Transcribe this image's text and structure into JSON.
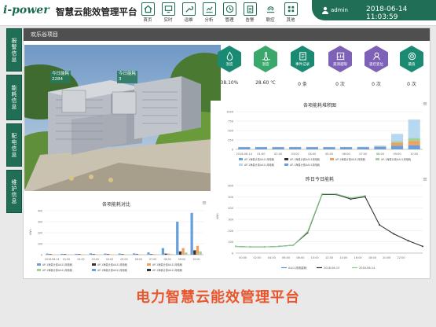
{
  "header": {
    "logo": "i-power",
    "title": "智慧云能效管理平台",
    "username": "admin",
    "datetime": "2018-06-14 11:03:59"
  },
  "nav": [
    {
      "label": "首页",
      "icon": "home-icon"
    },
    {
      "label": "实时",
      "icon": "monitor-icon"
    },
    {
      "label": "运维",
      "icon": "wrench-icon"
    },
    {
      "label": "分析",
      "icon": "chart-icon"
    },
    {
      "label": "管理",
      "icon": "clock-icon"
    },
    {
      "label": "告警",
      "icon": "clipboard-icon"
    },
    {
      "label": "联控",
      "icon": "link-icon"
    },
    {
      "label": "其他",
      "icon": "grid-icon"
    }
  ],
  "side_tabs": [
    "报警信息",
    "能耗信息",
    "配电信息",
    "维护信息"
  ],
  "panel": {
    "breadcrumb": "欢乐谷项目"
  },
  "scene": {
    "tag1": {
      "label": "今日能耗",
      "value": "2284"
    },
    "tag2": {
      "label": "今日能耗",
      "value": "3"
    }
  },
  "metrics": [
    {
      "name": "湿度",
      "value": "38.10%",
      "color": "#1a8a73",
      "icon": "droplet-icon"
    },
    {
      "name": "温度",
      "value": "28.60 ℃",
      "color": "#3aa86b",
      "icon": "thermometer-icon"
    },
    {
      "name": "事件记录",
      "value": "0 条",
      "color": "#1a8a73",
      "icon": "document-icon"
    },
    {
      "name": "遥测越限",
      "value": "0 次",
      "color": "#7d62b7",
      "icon": "gauge-icon"
    },
    {
      "name": "遥控变位",
      "value": "0 次",
      "color": "#7d62b7",
      "icon": "switch-icon"
    },
    {
      "name": "最值",
      "value": "0 次",
      "color": "#1a8a73",
      "icon": "target-icon"
    }
  ],
  "chart_data": [
    {
      "type": "bar",
      "title": "各项能耗堆积图",
      "categories": [
        "2018-06-14",
        "01:00",
        "02:00",
        "03:00",
        "04:00",
        "05:00",
        "06:00",
        "07:00",
        "08:00",
        "09:00",
        "10:00"
      ],
      "ylim": [
        0,
        1000
      ],
      "yticks": [
        0,
        250,
        500,
        750,
        1000
      ],
      "stacked": true,
      "series": [
        {
          "name": "AP-1海量计费AA11用电耗",
          "color": "#6aa0d8",
          "values": [
            60,
            60,
            60,
            60,
            60,
            60,
            60,
            60,
            70,
            100,
            110
          ]
        },
        {
          "name": "AP-1海量计费AA11用电耗",
          "color": "#333333",
          "values": [
            0,
            0,
            0,
            0,
            0,
            0,
            0,
            0,
            0,
            0,
            0
          ]
        },
        {
          "name": "AP-1海量计费AA11用电耗",
          "color": "#f0a060",
          "values": [
            5,
            5,
            5,
            5,
            5,
            5,
            5,
            5,
            10,
            80,
            110
          ]
        },
        {
          "name": "AP-1海量计费AA11用电耗",
          "color": "#9ed39e",
          "values": [
            0,
            0,
            0,
            0,
            0,
            0,
            0,
            0,
            0,
            30,
            80
          ]
        },
        {
          "name": "AP-1海量计费AA11用电耗",
          "color": "#b7d8f0",
          "values": [
            0,
            0,
            0,
            0,
            0,
            0,
            0,
            5,
            20,
            200,
            490
          ]
        }
      ],
      "legend": [
        "AP-1海量计费AA11用电耗",
        "AP-1海量计费AA11用电耗",
        "AP-1海量计费AA11用电耗",
        "AP-1海量计费AA11用电耗",
        "AP-1海量计费AA11用电耗",
        "AP-1海量计费AA11用电耗"
      ]
    },
    {
      "type": "line",
      "title": "昨日今日能耗",
      "ylabel": "kWh",
      "x": [
        "00:00",
        "02:00",
        "04:00",
        "06:00",
        "08:00",
        "10:00",
        "12:00",
        "14:00",
        "16:00",
        "18:00",
        "20:00",
        "22:00"
      ],
      "ylim": [
        0,
        600
      ],
      "yticks": [
        0,
        100,
        200,
        300,
        400,
        500,
        600
      ],
      "series": [
        {
          "name": "AA11用电能耗",
          "color": "#5b9bd5",
          "values": []
        },
        {
          "name": "2018-06-13",
          "color": "#333333",
          "values": [
            60,
            55,
            55,
            60,
            70,
            180,
            520,
            520,
            480,
            500,
            250,
            170,
            110,
            60
          ]
        },
        {
          "name": "2018-06-14",
          "color": "#8ccf8c",
          "values": [
            60,
            55,
            55,
            60,
            70,
            190,
            525,
            525,
            490,
            510
          ]
        }
      ],
      "xtick_count": 14
    },
    {
      "type": "bar",
      "title": "各项能耗对比",
      "ylabel": "kWh",
      "categories": [
        "2018-06-14",
        "01:00",
        "02:00",
        "03:00",
        "04:00",
        "05:00",
        "06:00",
        "07:00",
        "08:00",
        "09:00",
        "10:00"
      ],
      "ylim": [
        0,
        400
      ],
      "yticks": [
        0,
        100,
        200,
        300,
        400
      ],
      "series": [
        {
          "name": "AP-1海量计费AA11用电耗",
          "color": "#6aa0d8",
          "values": [
            10,
            8,
            8,
            12,
            10,
            10,
            12,
            20,
            60,
            300,
            380
          ]
        },
        {
          "name": "AP-1海量计费AA11用电耗",
          "color": "#333333",
          "values": [
            5,
            5,
            5,
            5,
            5,
            5,
            5,
            5,
            10,
            30,
            40
          ]
        },
        {
          "name": "AP-1海量计费AA11用电耗",
          "color": "#f0a060",
          "values": [
            3,
            3,
            3,
            3,
            3,
            3,
            3,
            5,
            10,
            60,
            80
          ]
        },
        {
          "name": "AP-1海量计费AA11用电耗",
          "color": "#9ed39e",
          "values": [
            2,
            2,
            2,
            2,
            2,
            2,
            2,
            3,
            5,
            20,
            30
          ]
        }
      ],
      "legend": [
        "AP-1海量计费AA11用电耗",
        "AP-1海量计费AA11用电耗",
        "AP-1海量计费AA11用电耗",
        "AP-1海量计费AA11用电耗",
        "AP-1海量计费AA11用电耗",
        "AP-1海量计费AA11用电耗"
      ]
    }
  ],
  "footer": {
    "caption": "电力智慧云能效管理平台"
  }
}
